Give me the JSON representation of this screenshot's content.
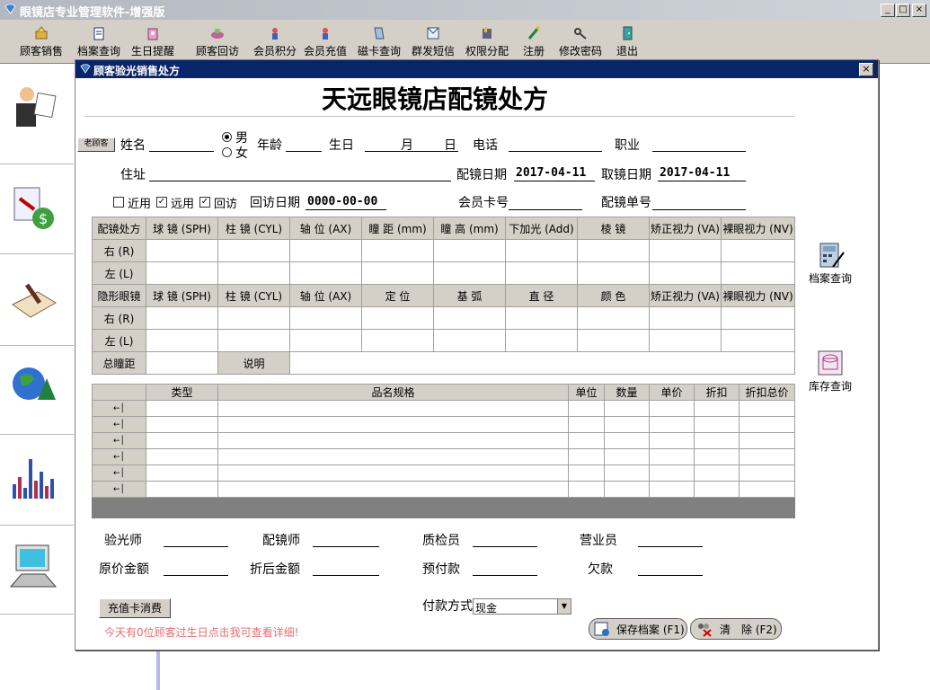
{
  "window": {
    "title": "眼镜店专业管理软件-增强版",
    "minimize": "_",
    "maximize": "□",
    "close": "×"
  },
  "toolbar": [
    "顾客销售",
    "档案查询",
    "生日提醒",
    "顾客回访",
    "会员积分",
    "会员充值",
    "磁卡查询",
    "群发短信",
    "权限分配",
    "注册",
    "修改密码",
    "退出"
  ],
  "dialog": {
    "title": "顾客验光销售处方",
    "close": "×",
    "heading": "天远眼镜店配镜处方",
    "old_customer_btn": "老顾客",
    "labels": {
      "name": "姓名",
      "male": "男",
      "female": "女",
      "age": "年龄",
      "birthday": "生日",
      "month": "月",
      "day": "日",
      "phone": "电话",
      "job": "职业",
      "address": "住址",
      "fit_date": "配镜日期",
      "pick_date": "取镜日期",
      "near": "近用",
      "far": "远用",
      "revisit": "回访",
      "revisit_date": "回访日期",
      "member_card": "会员卡号",
      "order_no": "配镜单号"
    },
    "values": {
      "fit_date": "2017-04-11",
      "pick_date": "2017-04-11",
      "revisit_date": "0000-00-00",
      "near": false,
      "far": true,
      "revisit": true,
      "gender": "male"
    },
    "rx": {
      "header1": [
        "配镜处方",
        "球 镜 (SPH)",
        "柱 镜 (CYL)",
        "轴 位 (AX)",
        "瞳 距 (mm)",
        "瞳 高 (mm)",
        "下加光 (Add)",
        "棱 镜",
        "矫正视力 (VA)",
        "裸眼视力 (NV)"
      ],
      "rows": [
        "右 (R)",
        "左 (L)"
      ],
      "header2": [
        "隐形眼镜",
        "球 镜 (SPH)",
        "柱 镜 (CYL)",
        "轴 位 (AX)",
        "定 位",
        "基 弧",
        "直 径",
        "颜 色",
        "矫正视力 (VA)",
        "裸眼视力 (NV)"
      ],
      "total_pd": "总瞳距",
      "note": "说明"
    },
    "products": {
      "headers": [
        "类型",
        "品名规格",
        "单位",
        "数量",
        "单价",
        "折扣",
        "折扣总价"
      ],
      "row_marks": [
        "←│",
        "←│",
        "←│",
        "←│",
        "←│",
        "←│"
      ]
    },
    "staff": {
      "optometrist": "验光师",
      "fitter": "配镜师",
      "inspector": "质检员",
      "sales": "营业员",
      "original_amount": "原价金额",
      "discount_amount": "折后金额",
      "prepaid": "预付款",
      "owed": "欠款"
    },
    "recharge_btn": "充值卡消费",
    "pay_method_label": "付款方式",
    "pay_method": "现金",
    "birthday_notice": "今天有0位顾客过生日点击我可查看详细!",
    "save_btn": "保存档案 (F1)",
    "clear_btn": "清　除 (F2)",
    "side_archive": "档案查询",
    "side_stock": "库存查询"
  }
}
